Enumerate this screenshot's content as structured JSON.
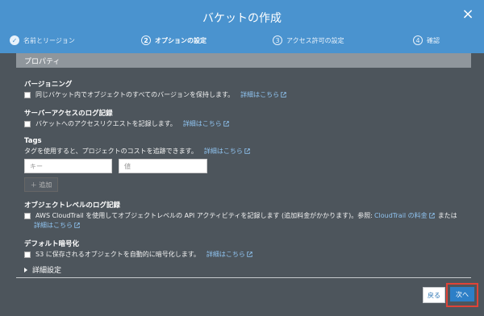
{
  "dialog": {
    "title": "バケットの作成",
    "close_label": "×",
    "steps": [
      {
        "number": "✓",
        "label": "名前とリージョン",
        "state": "done"
      },
      {
        "number": "2",
        "label": "オプションの設定",
        "state": "active"
      },
      {
        "number": "3",
        "label": "アクセス許可の設定",
        "state": "pending"
      },
      {
        "number": "4",
        "label": "確認",
        "state": "pending"
      }
    ]
  },
  "section": {
    "title": "プロパティ"
  },
  "versioning": {
    "title": "バージョニング",
    "description": "同じバケット内でオブジェクトのすべてのバージョンを保持します。",
    "link": "詳細はこちら"
  },
  "server_access_logging": {
    "title": "サーバーアクセスのログ記録",
    "description": "バケットへのアクセスリクエストを記録します。",
    "link": "詳細はこちら"
  },
  "tags": {
    "title": "Tags",
    "description": "タグを使用すると、プロジェクトのコストを追跡できます。",
    "link": "詳細はこちら",
    "key_placeholder": "キー",
    "value_placeholder": "値",
    "add_label": "＋ 追加"
  },
  "object_logging": {
    "title": "オブジェクトレベルのログ記録",
    "description": "AWS CloudTrail を使用してオブジェクトレベルの API アクティビティを記録します (追加料金がかかります)。参照:",
    "pricing_link": "CloudTrail の料金",
    "or": "または",
    "link": "詳細はこちら"
  },
  "default_encryption": {
    "title": "デフォルト暗号化",
    "description": "S3 に保存されるオブジェクトを自動的に暗号化します。",
    "link": "詳細はこちら"
  },
  "advanced": {
    "label": "詳細設定"
  },
  "footer": {
    "back_label": "戻る",
    "next_label": "次へ"
  }
}
